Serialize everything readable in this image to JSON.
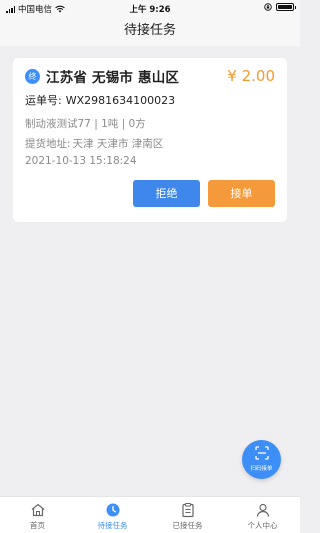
{
  "status_bar": {
    "carrier": "中国电信",
    "time": "上午 9:26"
  },
  "nav": {
    "title": "待接任务"
  },
  "task": {
    "badge": "终",
    "address": "江苏省 无锡市 惠山区",
    "price": "¥ 2.00",
    "waybill_label": "运单号:",
    "waybill_no": "WX2981634100023",
    "goods": "制动液测试77 | 1吨 | 0方",
    "pickup_label": "提货地址:",
    "pickup_address": "天津 天津市 津南区",
    "datetime": "2021-10-13 15:18:24",
    "reject_label": "拒绝",
    "accept_label": "接单"
  },
  "fab": {
    "label": "扫码接单",
    "icon": "scan-icon"
  },
  "tabs": [
    {
      "label": "首页",
      "icon": "home-icon",
      "active": false
    },
    {
      "label": "待接任务",
      "icon": "clock-icon",
      "active": true
    },
    {
      "label": "已接任务",
      "icon": "clipboard-icon",
      "active": false
    },
    {
      "label": "个人中心",
      "icon": "user-icon",
      "active": false
    }
  ],
  "colors": {
    "primary": "#3e8ef7",
    "accent": "#f59a3a",
    "price": "#f39a2d"
  }
}
